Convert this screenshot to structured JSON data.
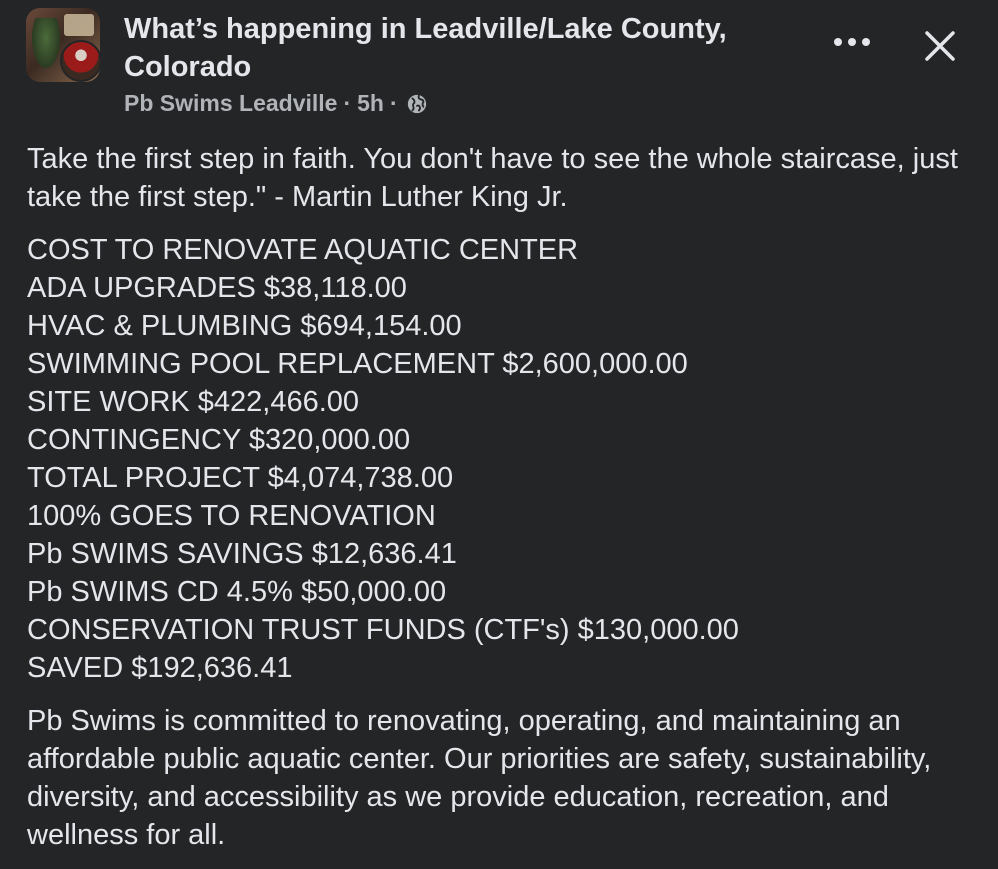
{
  "post": {
    "group_name": "What’s happening in Leadville/Lake County, Colorado",
    "author": "Pb Swims Leadville",
    "separator": "·",
    "time": "5h",
    "privacy_icon": "globe-icon",
    "more_icon": "more-options-icon",
    "close_icon": "close-icon"
  },
  "content": {
    "quote": "Take the first step in faith. You don't have to see the whole staircase, just take the first step.\" - Martin Luther King Jr.",
    "cost_lines": [
      "COST TO RENOVATE AQUATIC CENTER",
      "ADA UPGRADES $38,118.00",
      "HVAC & PLUMBING $694,154.00",
      "SWIMMING POOL REPLACEMENT $2,600,000.00",
      "SITE WORK $422,466.00",
      "CONTINGENCY $320,000.00",
      "TOTAL PROJECT $4,074,738.00",
      "100% GOES TO RENOVATION",
      "Pb SWIMS SAVINGS $12,636.41",
      "Pb SWIMS CD 4.5% $50,000.00",
      "CONSERVATION TRUST FUNDS (CTF's) $130,000.00",
      "SAVED $192,636.41"
    ],
    "mission": "Pb Swims is committed to renovating, operating, and maintaining an affordable public aquatic center. Our priorities are safety, sustainability, diversity, and accessibility as we provide education, recreation, and wellness for all."
  }
}
